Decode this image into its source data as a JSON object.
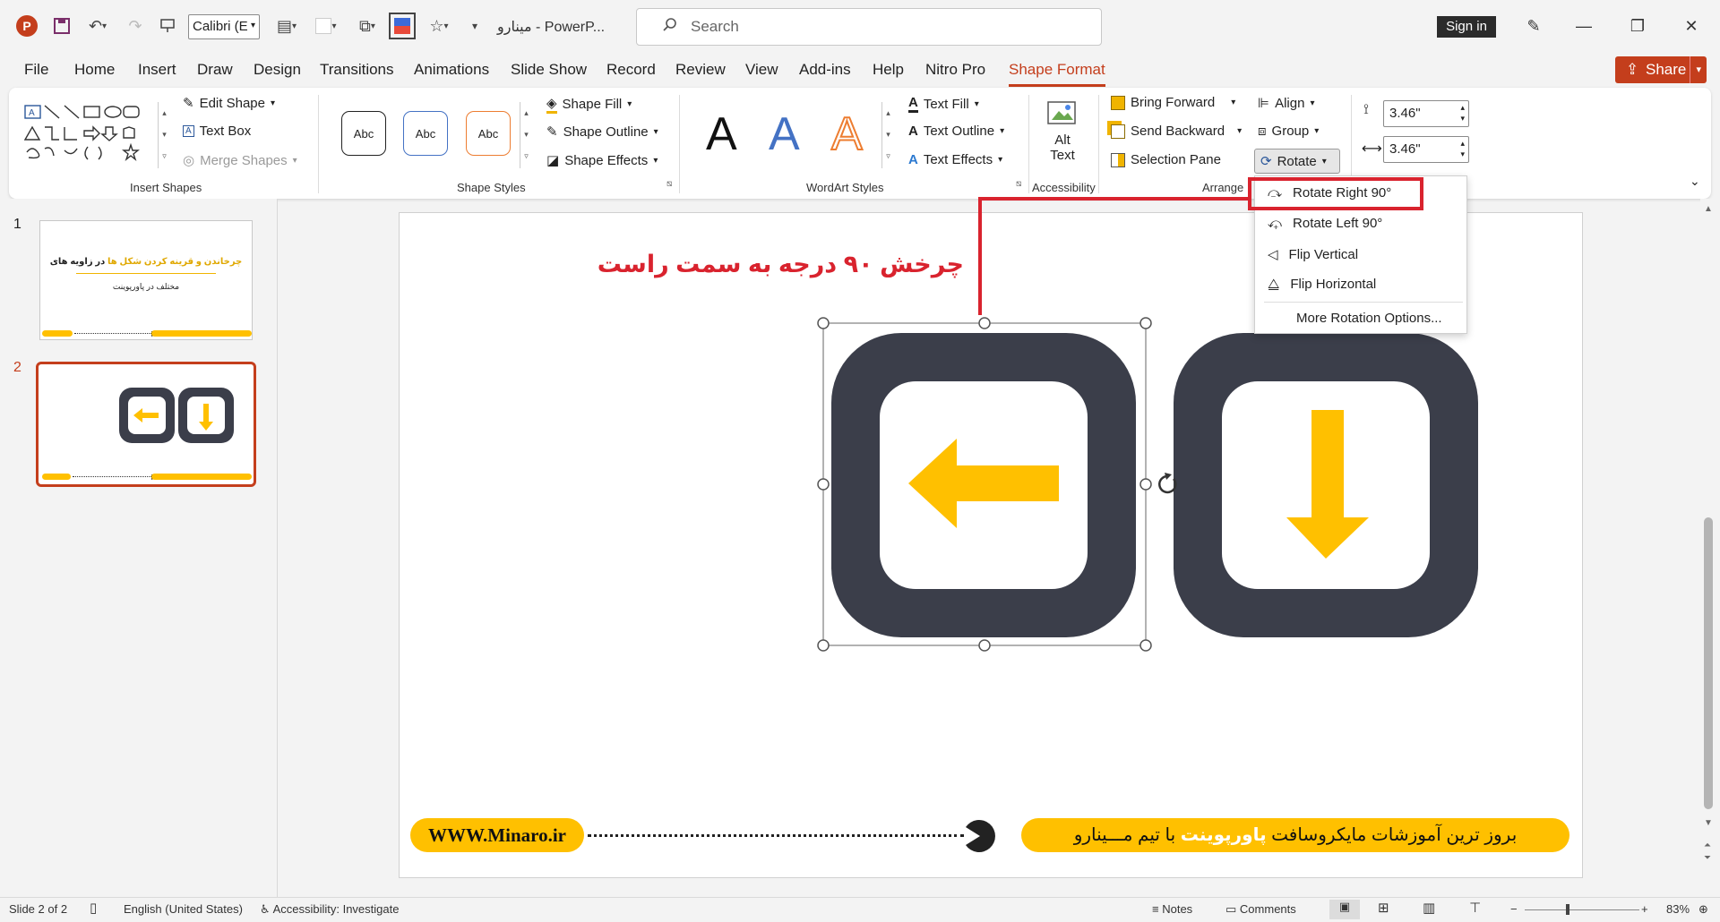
{
  "title_bar": {
    "font_name": "Calibri (E",
    "doc_title": "مینارو  -  PowerP...",
    "search_placeholder": "Search",
    "sign_in": "Sign in"
  },
  "menu": {
    "tabs": [
      "File",
      "Home",
      "Insert",
      "Draw",
      "Design",
      "Transitions",
      "Animations",
      "Slide Show",
      "Record",
      "Review",
      "View",
      "Add-ins",
      "Help",
      "Nitro Pro",
      "Shape Format"
    ],
    "active_tab": "Shape Format",
    "share": "Share"
  },
  "ribbon": {
    "insert_shapes": {
      "edit_shape": "Edit Shape",
      "text_box": "Text Box",
      "merge_shapes": "Merge Shapes",
      "group_label": "Insert Shapes"
    },
    "shape_styles": {
      "styles": [
        "Abc",
        "Abc",
        "Abc"
      ],
      "shape_fill": "Shape Fill",
      "shape_outline": "Shape Outline",
      "shape_effects": "Shape Effects",
      "group_label": "Shape Styles"
    },
    "wordart": {
      "letters": [
        "A",
        "A",
        "A"
      ],
      "text_fill": "Text Fill",
      "text_outline": "Text Outline",
      "text_effects": "Text Effects",
      "group_label": "WordArt Styles"
    },
    "accessibility": {
      "alt_text_1": "Alt",
      "alt_text_2": "Text",
      "group_label": "Accessibility"
    },
    "arrange": {
      "bring_forward": "Bring Forward",
      "send_backward": "Send Backward",
      "selection_pane": "Selection Pane",
      "align": "Align",
      "group": "Group",
      "rotate": "Rotate",
      "group_label": "Arrange"
    },
    "size": {
      "height": "3.46\"",
      "width": "3.46\""
    }
  },
  "rotate_menu": {
    "items": [
      "Rotate Right 90°",
      "Rotate Left 90°",
      "Flip Vertical",
      "Flip Horizontal",
      "More Rotation Options..."
    ]
  },
  "thumbnails": {
    "numbers": [
      "1",
      "2"
    ],
    "slide1_title_a": "چرخاندن و قرینه کردن شکل ها",
    "slide1_title_b": "در زاویه های",
    "slide1_subtitle": "مختلف در پاورپوینت"
  },
  "slide": {
    "annotation": "چرخش ۹۰ درجه به سمت راست",
    "footer_url": "WWW.Minaro.ir",
    "footer_text_a": "بروز ترین آموزشات مایکروسافت",
    "footer_text_b": "پاورپوینت",
    "footer_text_c": "با تیم مـــینارو"
  },
  "status_bar": {
    "slide_info": "Slide 2 of 2",
    "language": "English (United States)",
    "accessibility": "Accessibility: Investigate",
    "notes": "Notes",
    "comments": "Comments",
    "zoom": "83%"
  },
  "colors": {
    "accent": "#c43e1c",
    "icon_dark": "#3b3e4a",
    "arrow_yellow": "#ffc000",
    "annotation_red": "#d9232e"
  }
}
